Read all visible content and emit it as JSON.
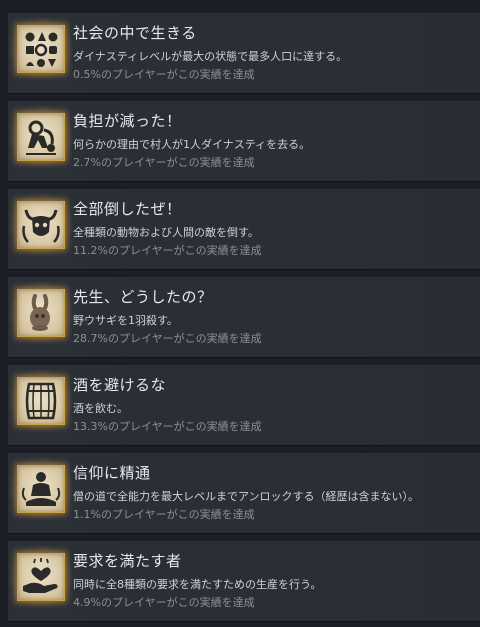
{
  "achievements": [
    {
      "icon": "community-symbols-icon",
      "title": "社会の中で生きる",
      "description": "ダイナスティレベルが最大の状態で最多人口に達する。",
      "unlock_rate": "0.5%のプレイヤーがこの実績を達成"
    },
    {
      "icon": "villager-carrying-load-icon",
      "title": "負担が減った！",
      "description": "何らかの理由で村人が1人ダイナスティを去る。",
      "unlock_rate": "2.7%のプレイヤーがこの実績を達成"
    },
    {
      "icon": "horned-beast-skull-icon",
      "title": "全部倒したぜ！",
      "description": "全種類の動物および人間の敵を倒す。",
      "unlock_rate": "11.2%のプレイヤーがこの実績を達成"
    },
    {
      "icon": "rabbit-icon",
      "title": "先生、どうしたの？",
      "description": "野ウサギを1羽殺す。",
      "unlock_rate": "28.7%のプレイヤーがこの実績を達成"
    },
    {
      "icon": "barrel-icon",
      "title": "酒を避けるな",
      "description": "酒を飲む。",
      "unlock_rate": "13.3%のプレイヤーがこの実績を達成"
    },
    {
      "icon": "meditating-monk-icon",
      "title": "信仰に精通",
      "description": "僧の道で全能力を最大レベルまでアンロックする（経歴は含まない）。",
      "unlock_rate": "1.1%のプレイヤーがこの実績を達成"
    },
    {
      "icon": "hand-giving-heart-icon",
      "title": "要求を満たす者",
      "description": "同時に全8種類の要求を満たすための生産を行う。",
      "unlock_rate": "4.9%のプレイヤーがこの実績を達成"
    }
  ]
}
